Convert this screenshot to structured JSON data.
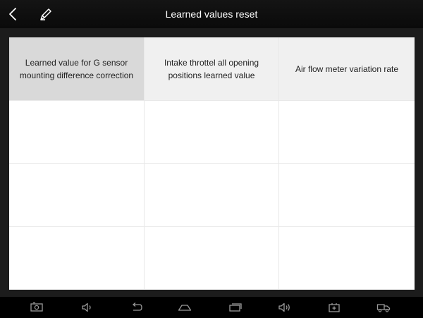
{
  "header": {
    "title": "Learned values reset"
  },
  "table": {
    "columns": [
      "Learned value for G sensor mounting difference correction",
      "Intake throttel all opening positions learned value",
      "Air flow meter variation rate"
    ],
    "selected_column": 0,
    "rows": [
      [
        "",
        "",
        ""
      ],
      [
        "",
        "",
        ""
      ],
      [
        "",
        "",
        ""
      ]
    ]
  },
  "icons": {
    "back": "back-arrow-icon",
    "edit": "edit-pencil-icon",
    "nav": [
      "screenshot-icon",
      "volume-down-icon",
      "nav-back-icon",
      "home-icon",
      "recent-apps-icon",
      "volume-up-icon",
      "vci-icon",
      "vehicle-icon"
    ]
  },
  "colors": {
    "header_bg": "#0b0b0b",
    "header_text": "#ffffff",
    "table_header_bg": "#f0f0f0",
    "table_header_selected_bg": "#d9d9d9",
    "grid_line": "#e8e8e8"
  }
}
